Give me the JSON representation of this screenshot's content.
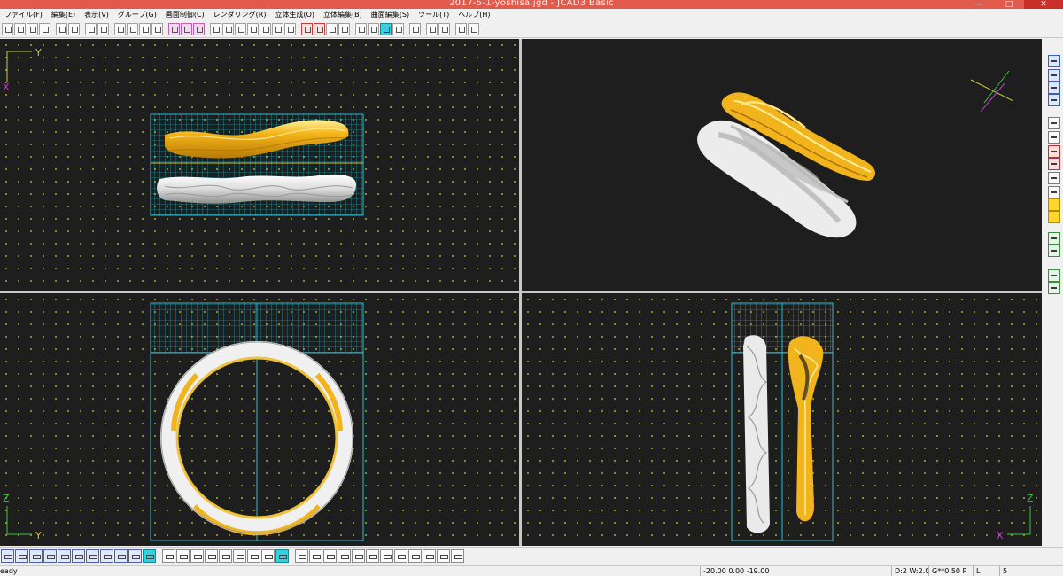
{
  "window": {
    "title": "2017-5-1-yoshisa.jgd - JCAD3 Basic",
    "minimize_glyph": "—",
    "maximize_glyph": "□",
    "close_glyph": "✕"
  },
  "menu": [
    "ファイル(F)",
    "編集(E)",
    "表示(V)",
    "グループ(G)",
    "画面制御(C)",
    "レンダリング(R)",
    "立体生成(O)",
    "立体編集(B)",
    "曲面編集(S)",
    "ツール(T)",
    "ヘルプ(H)"
  ],
  "viewports": {
    "top": {
      "axis_h": "Y",
      "axis_v": "X"
    },
    "front": {
      "axis_h": "Y",
      "axis_v": "Z"
    },
    "side": {
      "axis_h": "X",
      "axis_v": "Z"
    }
  },
  "status": {
    "message": "eady",
    "coordinates": "-20.00  0.00  -19.00",
    "grid_info": "D:2 W:2.0",
    "snap_info": "G**0.50 P",
    "mode": "L",
    "layer": "5"
  },
  "colors": {
    "grid": "#22bfd0",
    "gold": "#f2b41c",
    "silver": "#e6e6e6",
    "axis_yellow": "#c9c83a",
    "axis_magenta": "#c03ad0"
  }
}
